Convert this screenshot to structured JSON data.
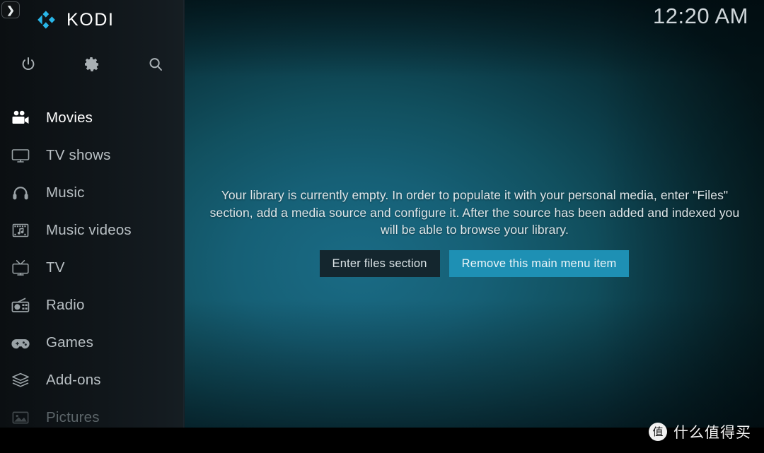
{
  "app": {
    "name": "KODI",
    "logo_color": "#29b6e8"
  },
  "sidebar": {
    "expand_button": "❯",
    "toolbar": [
      {
        "name": "power-icon",
        "label": "Power"
      },
      {
        "name": "gear-icon",
        "label": "Settings"
      },
      {
        "name": "search-icon",
        "label": "Search"
      }
    ],
    "items": [
      {
        "label": "Movies",
        "icon": "movie-camera-icon",
        "state": "active"
      },
      {
        "label": "TV shows",
        "icon": "tv-monitor-icon",
        "state": "normal"
      },
      {
        "label": "Music",
        "icon": "headphones-icon",
        "state": "normal"
      },
      {
        "label": "Music videos",
        "icon": "music-film-icon",
        "state": "normal"
      },
      {
        "label": "TV",
        "icon": "retro-tv-icon",
        "state": "normal"
      },
      {
        "label": "Radio",
        "icon": "radio-icon",
        "state": "normal"
      },
      {
        "label": "Games",
        "icon": "gamepad-icon",
        "state": "normal"
      },
      {
        "label": "Add-ons",
        "icon": "addon-box-icon",
        "state": "normal"
      },
      {
        "label": "Pictures",
        "icon": "picture-icon",
        "state": "dim"
      }
    ]
  },
  "header": {
    "clock": "12:20 AM"
  },
  "main": {
    "empty_message": "Your library is currently empty. In order to populate it with your personal media, enter \"Files\" section, add a media source and configure it. After the source has been added and indexed you will be able to browse your library.",
    "buttons": {
      "enter_files": "Enter files section",
      "remove_item": "Remove this main menu item"
    },
    "focused_button": "remove_item",
    "accent_color": "#1e90b4"
  },
  "watermark": {
    "badge": "值",
    "text": "什么值得买"
  }
}
